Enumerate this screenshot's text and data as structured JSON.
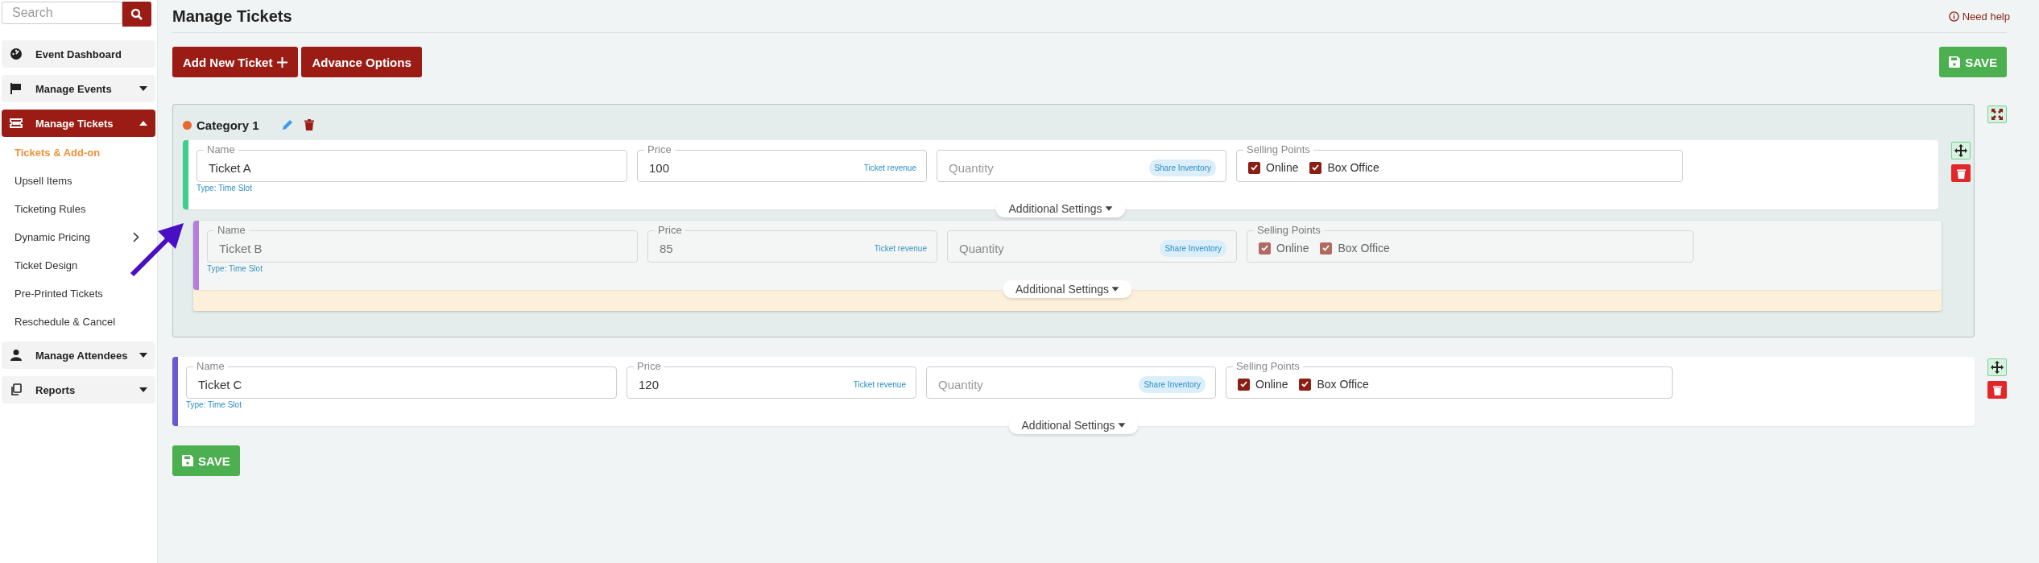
{
  "search": {
    "placeholder": "Search"
  },
  "sidebar": {
    "items": [
      {
        "label": "Event Dashboard",
        "kind": "link",
        "selected": false
      },
      {
        "label": "Manage Events",
        "kind": "group",
        "selected": false,
        "expanded": false
      },
      {
        "label": "Manage Tickets",
        "kind": "group",
        "selected": true,
        "expanded": true,
        "children": [
          {
            "label": "Tickets & Add-on",
            "kind": "link",
            "selected": true
          },
          {
            "label": "Upsell Items",
            "kind": "link",
            "selected": false
          },
          {
            "label": "Ticketing Rules",
            "kind": "link",
            "selected": false
          },
          {
            "label": "Dynamic Pricing",
            "kind": "submenu",
            "selected": false
          },
          {
            "label": "Ticket Design",
            "kind": "link",
            "selected": false
          },
          {
            "label": "Pre-Printed Tickets",
            "kind": "link",
            "selected": false
          },
          {
            "label": "Reschedule & Cancel",
            "kind": "link",
            "selected": false
          }
        ]
      },
      {
        "label": "Manage Attendees",
        "kind": "group",
        "selected": false,
        "expanded": false
      },
      {
        "label": "Reports",
        "kind": "group",
        "selected": false,
        "expanded": false
      }
    ]
  },
  "header": {
    "title": "Manage Tickets",
    "help": "Need help"
  },
  "toolbar": {
    "buttons": [
      "Add New Ticket",
      "Advance Options"
    ],
    "save": "SAVE"
  },
  "category": {
    "name": "Category 1",
    "color": "#e8692d",
    "tickets": [
      {
        "color": "#3ecf8e",
        "dragging": false,
        "name_label": "Name",
        "name": "Ticket A",
        "type": "Type: Time Slot",
        "price_label": "Price",
        "price": "100",
        "price_hint": "Ticket revenue",
        "quantity_placeholder": "Quantity",
        "share": "Share Inventory",
        "selling_label": "Selling Points",
        "channels": [
          {
            "label": "Online",
            "checked": true
          },
          {
            "label": "Box Office",
            "checked": true
          }
        ],
        "settings": "Additional Settings"
      },
      {
        "color": "#b57edc",
        "dragging": true,
        "name_label": "Name",
        "name": "Ticket B",
        "type": "Type: Time Slot",
        "price_label": "Price",
        "price": "85",
        "price_hint": "Ticket revenue",
        "quantity_placeholder": "Quantity",
        "share": "Share Inventory",
        "selling_label": "Selling Points",
        "channels": [
          {
            "label": "Online",
            "checked": true
          },
          {
            "label": "Box Office",
            "checked": true
          }
        ],
        "settings": "Additional Settings"
      }
    ]
  },
  "uncategorized": [
    {
      "color": "#6a5acd",
      "dragging": false,
      "name_label": "Name",
      "name": "Ticket C",
      "type": "Type: Time Slot",
      "price_label": "Price",
      "price": "120",
      "price_hint": "Ticket revenue",
      "quantity_placeholder": "Quantity",
      "share": "Share Inventory",
      "selling_label": "Selling Points",
      "channels": [
        {
          "label": "Online",
          "checked": true
        },
        {
          "label": "Box Office",
          "checked": true
        }
      ],
      "settings": "Additional Settings"
    }
  ],
  "footer_save": "SAVE"
}
